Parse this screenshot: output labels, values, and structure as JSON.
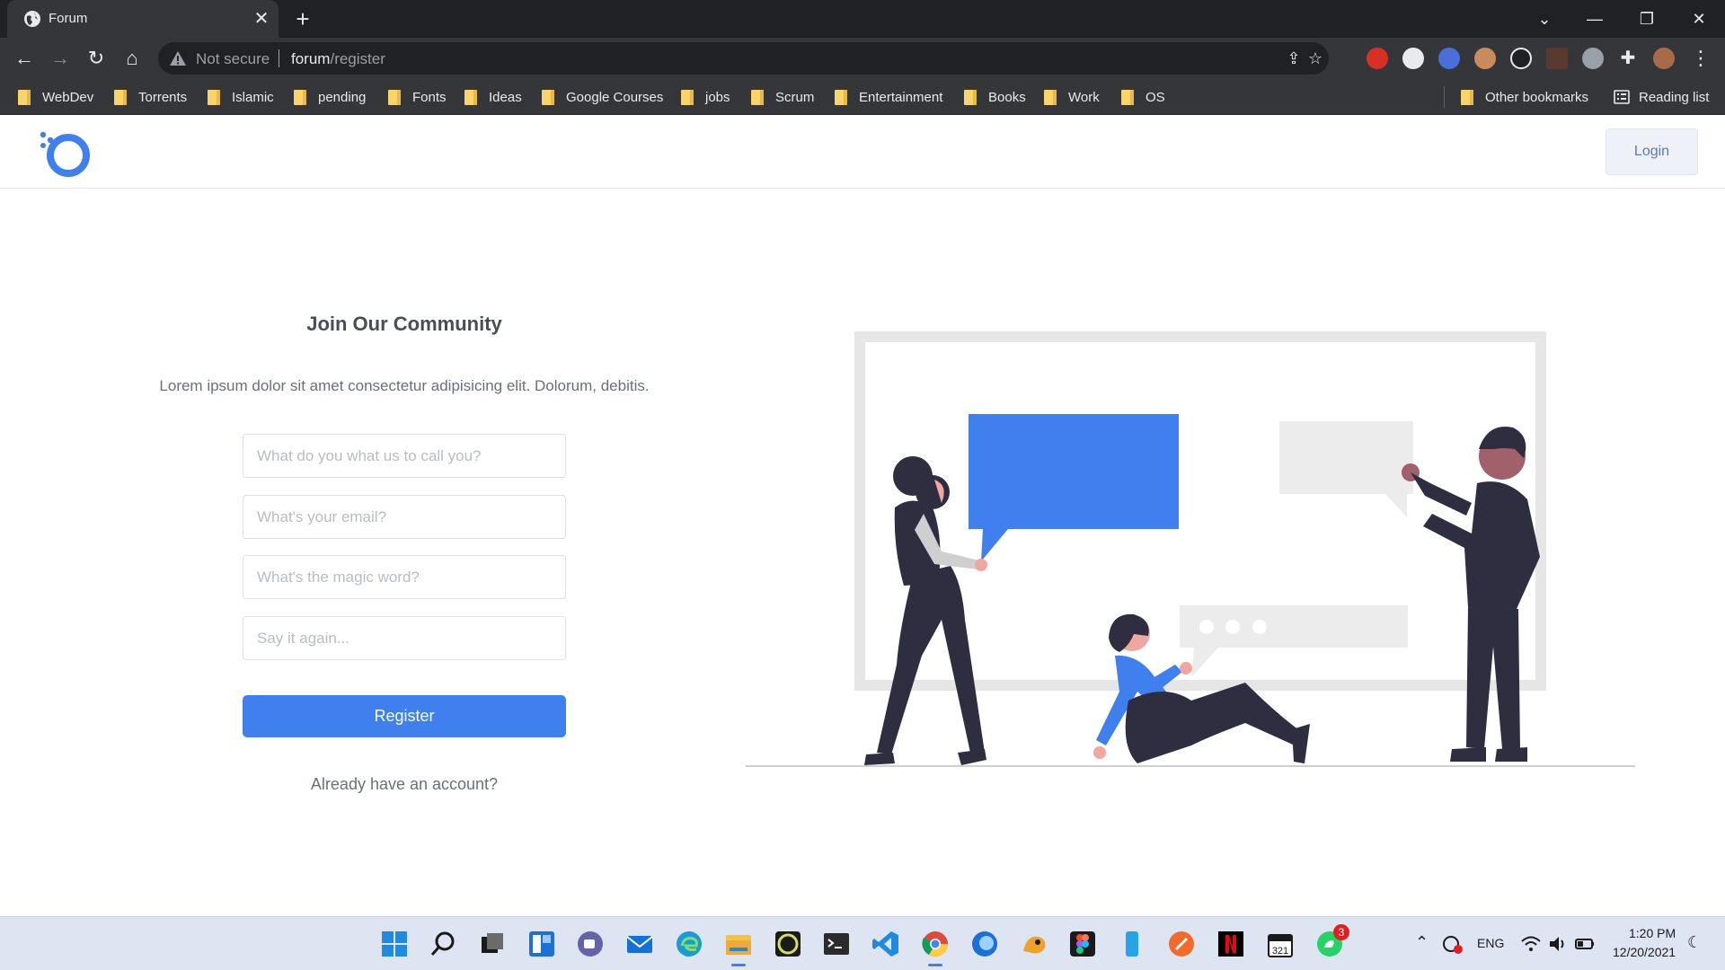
{
  "browser": {
    "tab_title": "Forum",
    "tab_close": "✕",
    "new_tab": "+",
    "address": {
      "security_label": "Not secure",
      "host": "forum",
      "path": "/register"
    },
    "bookmarks": [
      "WebDev",
      "Torrents",
      "Islamic",
      "pending",
      "Fonts",
      "Ideas",
      "Google Courses",
      "jobs",
      "Scrum",
      "Entertainment",
      "Books",
      "Work",
      "OS"
    ],
    "other_bookmarks": "Other bookmarks",
    "reading_list": "Reading list"
  },
  "header": {
    "login_label": "Login"
  },
  "form": {
    "title": "Join Our Community",
    "subtitle": "Lorem ipsum dolor sit amet consectetur adipisicing elit. Dolorum, debitis.",
    "name_placeholder": "What do you what us to call you?",
    "email_placeholder": "What's your email?",
    "password_placeholder": "What's the magic word?",
    "confirm_placeholder": "Say it again...",
    "register_label": "Register",
    "already_account": "Already have an account?"
  },
  "taskbar": {
    "lang": "ENG",
    "time": "1:20 PM",
    "date": "12/20/2021",
    "whatsapp_badge": "3",
    "apps": [
      "windows-start",
      "search",
      "task-view",
      "widgets",
      "teams-chat",
      "mail",
      "edge",
      "file-explorer",
      "app-green",
      "terminal",
      "vscode",
      "chrome",
      "firefox",
      "app-orange",
      "figma",
      "app-blue",
      "app-orange-circle",
      "netflix",
      "calendar-app",
      "whatsapp"
    ]
  },
  "colors": {
    "accent": "#3f80ee",
    "chrome_dark": "#202124",
    "chrome_mid": "#35363a",
    "figure_dark": "#2f2e41"
  }
}
